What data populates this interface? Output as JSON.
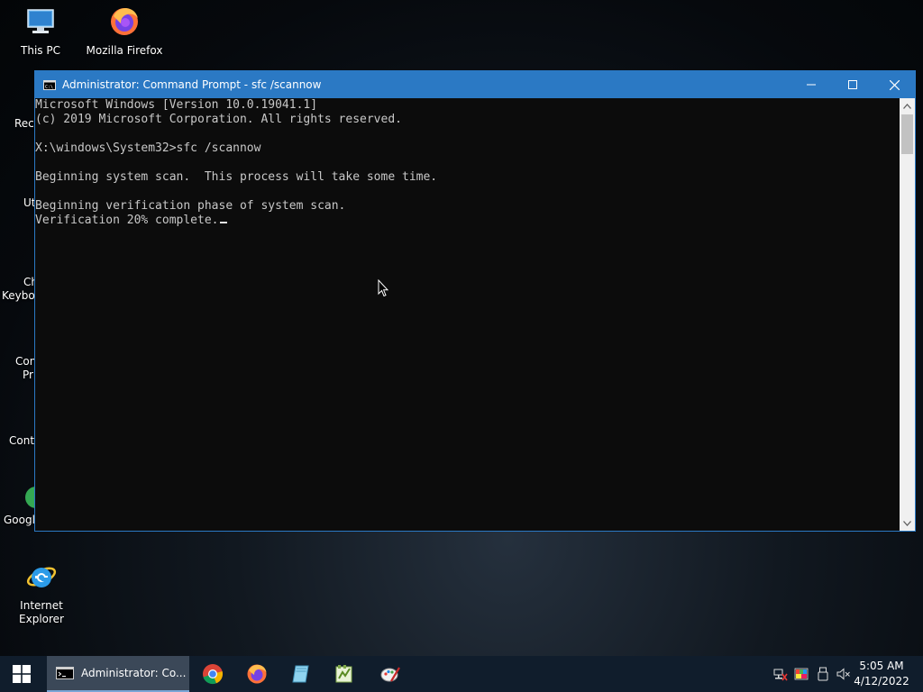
{
  "desktop": {
    "icons": [
      {
        "label": "This PC"
      },
      {
        "label": "Mozilla Firefox"
      },
      {
        "label": "Internet Explorer"
      }
    ],
    "partial_icons": [
      {
        "label": "Recy"
      },
      {
        "label": "Ut"
      },
      {
        "label": "Ch"
      },
      {
        "label": "Keyboa"
      },
      {
        "label": "Con"
      },
      {
        "label": "Pr"
      },
      {
        "label": "Contr"
      },
      {
        "label": "Googl"
      }
    ]
  },
  "window": {
    "title": "Administrator: Command Prompt - sfc  /scannow",
    "accent_color": "#2b79c4",
    "console_lines": [
      "Microsoft Windows [Version 10.0.19041.1]",
      "(c) 2019 Microsoft Corporation. All rights reserved.",
      "",
      "X:\\windows\\System32>sfc /scannow",
      "",
      "Beginning system scan.  This process will take some time.",
      "",
      "Beginning verification phase of system scan.",
      "Verification 20% complete."
    ]
  },
  "taskbar": {
    "active_task_label": "Administrator: Co...",
    "pinned": [
      "chrome-icon",
      "firefox-icon",
      "notepad-icon",
      "notepad-plus-icon",
      "paint-icon"
    ],
    "tray": [
      "network-icon",
      "color-icon",
      "usb-icon",
      "volume-muted-icon"
    ],
    "time": "5:05 AM",
    "date": "4/12/2022"
  }
}
